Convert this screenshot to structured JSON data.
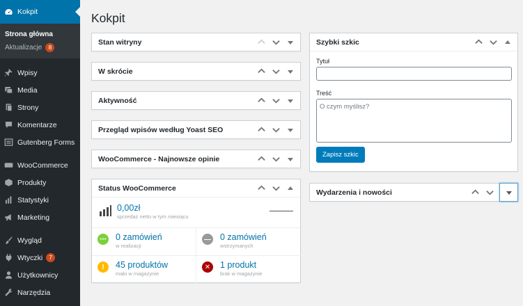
{
  "sidebar": {
    "dashboard_label": "Kokpit",
    "submenu": {
      "home_label": "Strona główna",
      "updates_label": "Aktualizacje",
      "updates_count": "8"
    },
    "items": [
      {
        "label": "Wpisy",
        "icon": "pin-icon"
      },
      {
        "label": "Media",
        "icon": "media-icon"
      },
      {
        "label": "Strony",
        "icon": "page-icon"
      },
      {
        "label": "Komentarze",
        "icon": "comment-icon"
      },
      {
        "label": "Gutenberg Forms",
        "icon": "form-icon"
      },
      {
        "label": "WooCommerce",
        "icon": "woo-icon"
      },
      {
        "label": "Produkty",
        "icon": "box-icon"
      },
      {
        "label": "Statystyki",
        "icon": "bar-chart-icon"
      },
      {
        "label": "Marketing",
        "icon": "megaphone-icon"
      },
      {
        "label": "Wygląd",
        "icon": "brush-icon"
      },
      {
        "label": "Wtyczki",
        "icon": "plug-icon",
        "badge": "7"
      },
      {
        "label": "Użytkownicy",
        "icon": "user-icon"
      },
      {
        "label": "Narzędzia",
        "icon": "wrench-icon"
      }
    ]
  },
  "page_title": "Kokpit",
  "left_boxes": [
    {
      "title": "Stan witryny"
    },
    {
      "title": "W skrócie"
    },
    {
      "title": "Aktywność"
    },
    {
      "title": "Przegląd wpisów według Yoast SEO"
    },
    {
      "title": "WooCommerce - Najnowsze opinie"
    }
  ],
  "wc_status": {
    "title": "Status WooCommerce",
    "sales_value": "0,00zł",
    "sales_desc": "sprzedaż netto w tym miesiącu",
    "processing_value": "0 zamówień",
    "processing_desc": "w realizacji",
    "onhold_value": "0 zamówień",
    "onhold_desc": "wstrzymanych",
    "lowstock_value": "45 produktów",
    "lowstock_desc": "mało w magazynie",
    "outstock_value": "1 produkt",
    "outstock_desc": "brak w magazynie"
  },
  "quick_draft": {
    "title": "Szybki szkic",
    "title_label": "Tytuł",
    "content_label": "Treść",
    "content_placeholder": "O czym myślisz?",
    "save_label": "Zapisz szkic"
  },
  "events": {
    "title": "Wydarzenia i nowości"
  },
  "colors": {
    "accent": "#0073aa",
    "sidebar_bg": "#23282d",
    "badge": "#ca4a1f",
    "green": "#7ad03a",
    "grey": "#999999",
    "yellow": "#ffba00",
    "red": "#a00000"
  }
}
